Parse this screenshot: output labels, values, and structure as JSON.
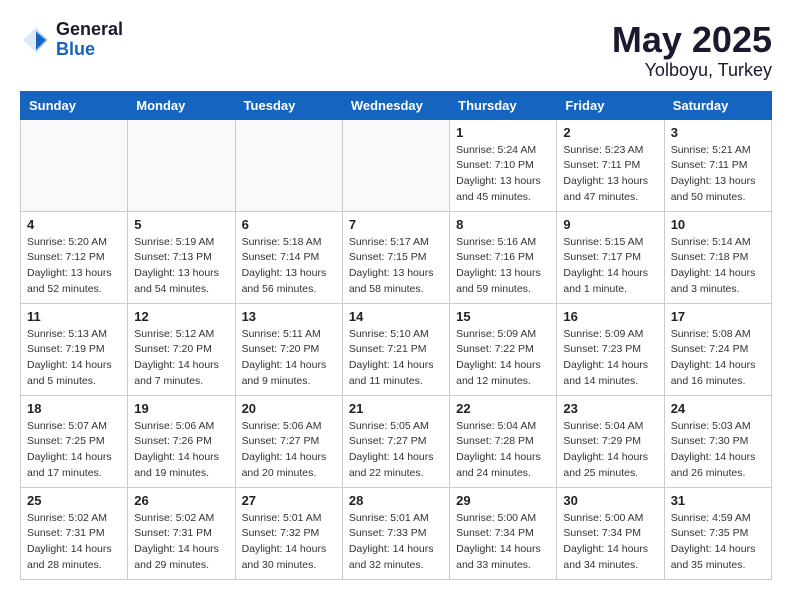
{
  "header": {
    "logo_general": "General",
    "logo_blue": "Blue",
    "month_year": "May 2025",
    "location": "Yolboyu, Turkey"
  },
  "weekdays": [
    "Sunday",
    "Monday",
    "Tuesday",
    "Wednesday",
    "Thursday",
    "Friday",
    "Saturday"
  ],
  "weeks": [
    [
      {
        "day": "",
        "info": ""
      },
      {
        "day": "",
        "info": ""
      },
      {
        "day": "",
        "info": ""
      },
      {
        "day": "",
        "info": ""
      },
      {
        "day": "1",
        "info": "Sunrise: 5:24 AM\nSunset: 7:10 PM\nDaylight: 13 hours\nand 45 minutes."
      },
      {
        "day": "2",
        "info": "Sunrise: 5:23 AM\nSunset: 7:11 PM\nDaylight: 13 hours\nand 47 minutes."
      },
      {
        "day": "3",
        "info": "Sunrise: 5:21 AM\nSunset: 7:11 PM\nDaylight: 13 hours\nand 50 minutes."
      }
    ],
    [
      {
        "day": "4",
        "info": "Sunrise: 5:20 AM\nSunset: 7:12 PM\nDaylight: 13 hours\nand 52 minutes."
      },
      {
        "day": "5",
        "info": "Sunrise: 5:19 AM\nSunset: 7:13 PM\nDaylight: 13 hours\nand 54 minutes."
      },
      {
        "day": "6",
        "info": "Sunrise: 5:18 AM\nSunset: 7:14 PM\nDaylight: 13 hours\nand 56 minutes."
      },
      {
        "day": "7",
        "info": "Sunrise: 5:17 AM\nSunset: 7:15 PM\nDaylight: 13 hours\nand 58 minutes."
      },
      {
        "day": "8",
        "info": "Sunrise: 5:16 AM\nSunset: 7:16 PM\nDaylight: 13 hours\nand 59 minutes."
      },
      {
        "day": "9",
        "info": "Sunrise: 5:15 AM\nSunset: 7:17 PM\nDaylight: 14 hours\nand 1 minute."
      },
      {
        "day": "10",
        "info": "Sunrise: 5:14 AM\nSunset: 7:18 PM\nDaylight: 14 hours\nand 3 minutes."
      }
    ],
    [
      {
        "day": "11",
        "info": "Sunrise: 5:13 AM\nSunset: 7:19 PM\nDaylight: 14 hours\nand 5 minutes."
      },
      {
        "day": "12",
        "info": "Sunrise: 5:12 AM\nSunset: 7:20 PM\nDaylight: 14 hours\nand 7 minutes."
      },
      {
        "day": "13",
        "info": "Sunrise: 5:11 AM\nSunset: 7:20 PM\nDaylight: 14 hours\nand 9 minutes."
      },
      {
        "day": "14",
        "info": "Sunrise: 5:10 AM\nSunset: 7:21 PM\nDaylight: 14 hours\nand 11 minutes."
      },
      {
        "day": "15",
        "info": "Sunrise: 5:09 AM\nSunset: 7:22 PM\nDaylight: 14 hours\nand 12 minutes."
      },
      {
        "day": "16",
        "info": "Sunrise: 5:09 AM\nSunset: 7:23 PM\nDaylight: 14 hours\nand 14 minutes."
      },
      {
        "day": "17",
        "info": "Sunrise: 5:08 AM\nSunset: 7:24 PM\nDaylight: 14 hours\nand 16 minutes."
      }
    ],
    [
      {
        "day": "18",
        "info": "Sunrise: 5:07 AM\nSunset: 7:25 PM\nDaylight: 14 hours\nand 17 minutes."
      },
      {
        "day": "19",
        "info": "Sunrise: 5:06 AM\nSunset: 7:26 PM\nDaylight: 14 hours\nand 19 minutes."
      },
      {
        "day": "20",
        "info": "Sunrise: 5:06 AM\nSunset: 7:27 PM\nDaylight: 14 hours\nand 20 minutes."
      },
      {
        "day": "21",
        "info": "Sunrise: 5:05 AM\nSunset: 7:27 PM\nDaylight: 14 hours\nand 22 minutes."
      },
      {
        "day": "22",
        "info": "Sunrise: 5:04 AM\nSunset: 7:28 PM\nDaylight: 14 hours\nand 24 minutes."
      },
      {
        "day": "23",
        "info": "Sunrise: 5:04 AM\nSunset: 7:29 PM\nDaylight: 14 hours\nand 25 minutes."
      },
      {
        "day": "24",
        "info": "Sunrise: 5:03 AM\nSunset: 7:30 PM\nDaylight: 14 hours\nand 26 minutes."
      }
    ],
    [
      {
        "day": "25",
        "info": "Sunrise: 5:02 AM\nSunset: 7:31 PM\nDaylight: 14 hours\nand 28 minutes."
      },
      {
        "day": "26",
        "info": "Sunrise: 5:02 AM\nSunset: 7:31 PM\nDaylight: 14 hours\nand 29 minutes."
      },
      {
        "day": "27",
        "info": "Sunrise: 5:01 AM\nSunset: 7:32 PM\nDaylight: 14 hours\nand 30 minutes."
      },
      {
        "day": "28",
        "info": "Sunrise: 5:01 AM\nSunset: 7:33 PM\nDaylight: 14 hours\nand 32 minutes."
      },
      {
        "day": "29",
        "info": "Sunrise: 5:00 AM\nSunset: 7:34 PM\nDaylight: 14 hours\nand 33 minutes."
      },
      {
        "day": "30",
        "info": "Sunrise: 5:00 AM\nSunset: 7:34 PM\nDaylight: 14 hours\nand 34 minutes."
      },
      {
        "day": "31",
        "info": "Sunrise: 4:59 AM\nSunset: 7:35 PM\nDaylight: 14 hours\nand 35 minutes."
      }
    ]
  ]
}
